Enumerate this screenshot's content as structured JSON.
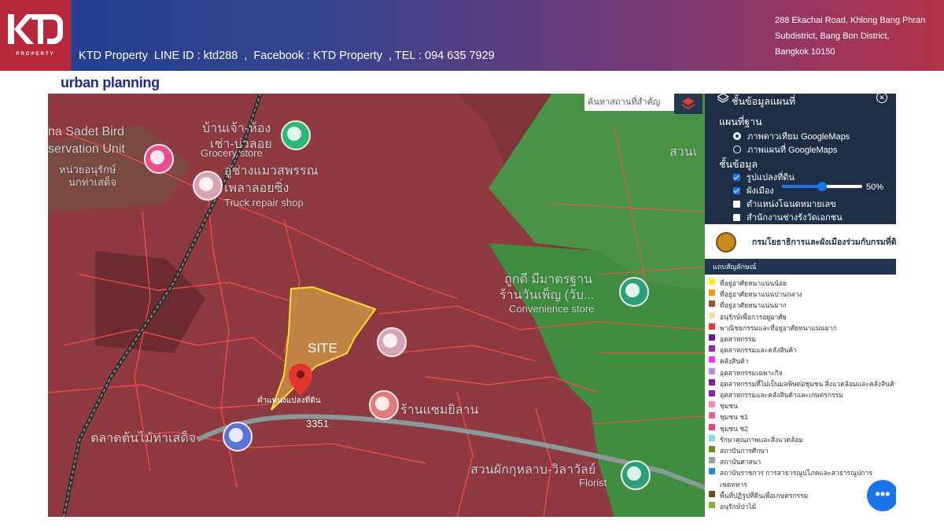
{
  "header": {
    "logo_text": "KTD",
    "logo_sub": "PROPERTY",
    "contact_line": "KTD Property  LINE ID : ktd288  ,  Facebook : KTD Property  , TEL : 094 635 7929",
    "address_lines": [
      "288 Ekachai Road, Khlong Bang Phran",
      "Subdistrict, Bang Bon District,",
      "Bangkok 10150"
    ],
    "colors": {
      "gradient_start": "#1f3f8f",
      "gradient_end": "#b43349",
      "logo_bg": "#b8283a"
    }
  },
  "section_title": "urban planning",
  "map": {
    "site_label": "SITE",
    "pin_caption": "ตำแหน่งแปลงที่ดิน",
    "labels": {
      "bird": "na Sadet Bird",
      "observation": "servation Unit",
      "bird_thai1": "หน่วยอนุรักษ์",
      "bird_thai2": "นกท่าเสด็จ",
      "grocery_thai1": "บ้านเจ้า-ห้อง",
      "grocery_thai2": "เช่า-บ่วลอย",
      "grocery": "Grocery store",
      "truck_thai1": "อู่ช่างแมวสพรรณ",
      "truck_thai2": "เพลาลอยซิ่ง",
      "truck": "Truck repair shop",
      "convenience_thai1": "ถูกดี มีมาตรฐาน",
      "convenience_thai2": "ร้านวันเพ็ญ (วับ...",
      "convenience": "Convenience store",
      "shop_thai": "ร้านแซมยิลาน",
      "market_thai": "ตลาดต้นไม้ท่าเสด็จ",
      "florist_thai": "สวนผักกุหลาบ-วิลาวัลย์",
      "florist": "Florist",
      "park_thai": "สวนเ",
      "road_code": "3351"
    },
    "colors": {
      "red_zone": "#8e3a40",
      "green_zone": "#3b8f3f",
      "site_fill": "#c89044",
      "site_outline": "#ffe033",
      "parcel_line": "#ff3b3b"
    },
    "search_placeholder": "ค้นหาสถานที่สำคัญ",
    "layers_icon": "layers-icon"
  },
  "layer_panel": {
    "title": "ชั้นข้อมูลแผนที่",
    "basemap_head": "แผนที่ฐาน",
    "basemaps": [
      {
        "label": "ภาพดาวเทียม GoogleMaps",
        "selected": true
      },
      {
        "label": "ภาพแผนที่ GoogleMaps",
        "selected": false
      }
    ],
    "layers_head": "ชั้นข้อมูล",
    "layers": [
      {
        "label": "รูปแปลงที่ดิน",
        "checked": true
      },
      {
        "label": "ผังเมือง",
        "checked": true
      },
      {
        "label": "ตำแหน่งโฉนดหมายเลข",
        "checked": false
      },
      {
        "label": "สำนักงานช่างรังวัดเอกชน",
        "checked": false
      }
    ],
    "opacity_value": 0.5,
    "opacity_label": "50%"
  },
  "agency_text": "กรมโยธาธิการและผังเมืองร่วมกับกรมที่ดิน",
  "legend": {
    "head": "แถบสัญลักษณ์",
    "items": [
      {
        "label": "ที่อยู่อาศัยหนาแน่นน้อย",
        "color": "#ffee00"
      },
      {
        "label": "ที่อยู่อาศัยหนาแน่นปานกลาง",
        "color": "#f39c12"
      },
      {
        "label": "ที่อยู่อาศัยหนาแน่นมาก",
        "color": "#a0522d"
      },
      {
        "label": "อนุรักษ์เพื่อการอยู่อาศัย",
        "color": "#f5e6a8"
      },
      {
        "label": "พาณิชยกรรมและที่อยู่อาศัยหนาแน่นมาก",
        "color": "#e53935"
      },
      {
        "label": "อุตสาหกรรม",
        "color": "#6a1b9a"
      },
      {
        "label": "อุตสาหกรรมและคลังสินค้า",
        "color": "#9c27b0"
      },
      {
        "label": "คลังสินค้า",
        "color": "#e040fb"
      },
      {
        "label": "อุตสาหกรรมเฉพาะกิจ",
        "color": "#ba8fd6"
      },
      {
        "label": "อุตสาหกรรมที่ไม่เป็นมลพิษต่อชุมชน สิ่งแวดล้อมและคลังสินค้า",
        "color": "#7b1fa2"
      },
      {
        "label": "อุตสาหกรรมและคลังสินค้าและเกษตรกรรม",
        "color": "#8e24aa"
      },
      {
        "label": "ชุมชน",
        "color": "#f48fb1"
      },
      {
        "label": "ชุมชน ช1",
        "color": "#f06292"
      },
      {
        "label": "ชุมชน ช2",
        "color": "#ec407a"
      },
      {
        "label": "รักษาคุณภาพและสิ่งแวดล้อม",
        "color": "#80deea"
      },
      {
        "label": "สถาบันการศึกษา",
        "color": "#6b8e23"
      },
      {
        "label": "สถาบันศาสนา",
        "color": "#9e9e9e"
      },
      {
        "label": "สถาบันราชการ การสาธารณูปโภคและสาธารณูปการ",
        "color": "#1e88e5"
      },
      {
        "label": "เขตทหาร",
        "color": ""
      },
      {
        "label": "พื้นที่ปฏิรูปที่ดินเพื่อเกษตรกรรม",
        "color": "#6d4c1a"
      },
      {
        "label": "อนุรักษ์ป่าไม้",
        "color": "#7cb342"
      }
    ]
  },
  "fab_label": "•••"
}
